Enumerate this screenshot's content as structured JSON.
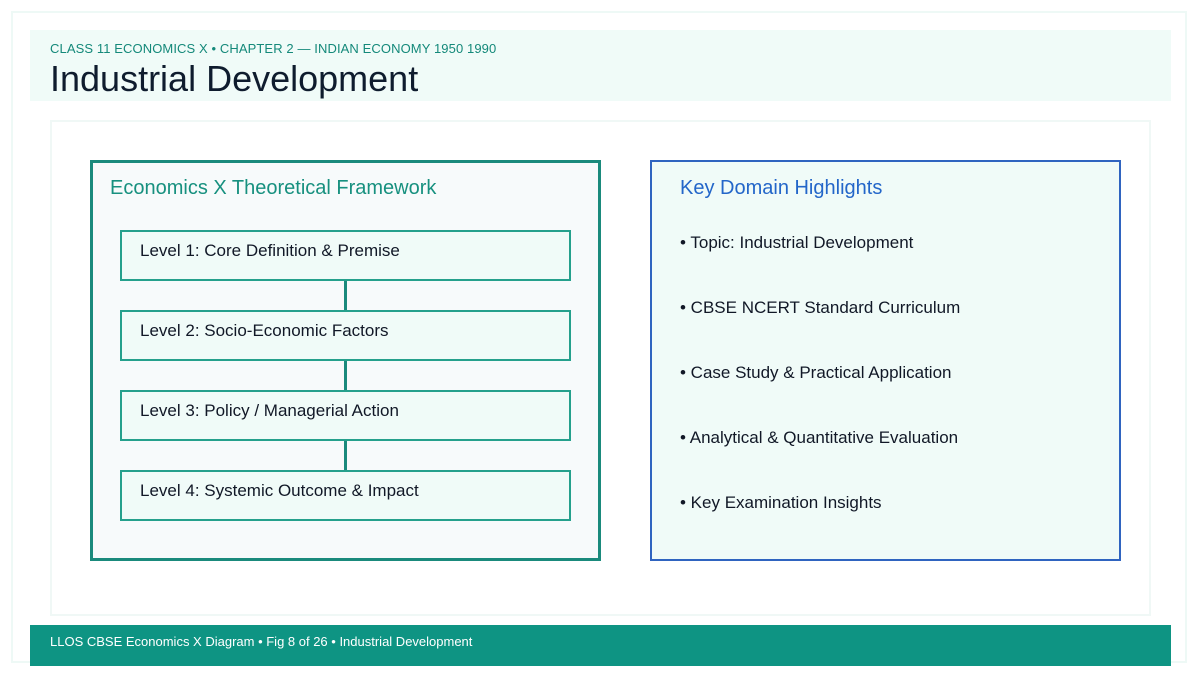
{
  "header": {
    "subtitle": "CLASS 11 ECONOMICS X • CHAPTER 2 — INDIAN ECONOMY 1950 1990",
    "title": "Industrial Development"
  },
  "framework": {
    "title": "Economics X Theoretical Framework",
    "levels": [
      "Level 1: Core Definition & Premise",
      "Level 2: Socio-Economic Factors",
      "Level 3: Policy / Managerial Action",
      "Level 4: Systemic Outcome & Impact"
    ]
  },
  "highlights": {
    "title": "Key Domain Highlights",
    "items": [
      "• Topic: Industrial Development",
      "• CBSE NCERT Standard Curriculum",
      "• Case Study & Practical Application",
      "• Analytical & Quantitative Evaluation",
      "• Key Examination Insights"
    ]
  },
  "footer": {
    "text": "LLOS CBSE Economics X Diagram • Fig 8 of 26 • Industrial Development"
  },
  "colors": {
    "teal_primary": "#1a8a7c",
    "teal_footer": "#0e9483",
    "blue_accent": "#2f64c0",
    "mint_fill": "#f0fbf8"
  }
}
